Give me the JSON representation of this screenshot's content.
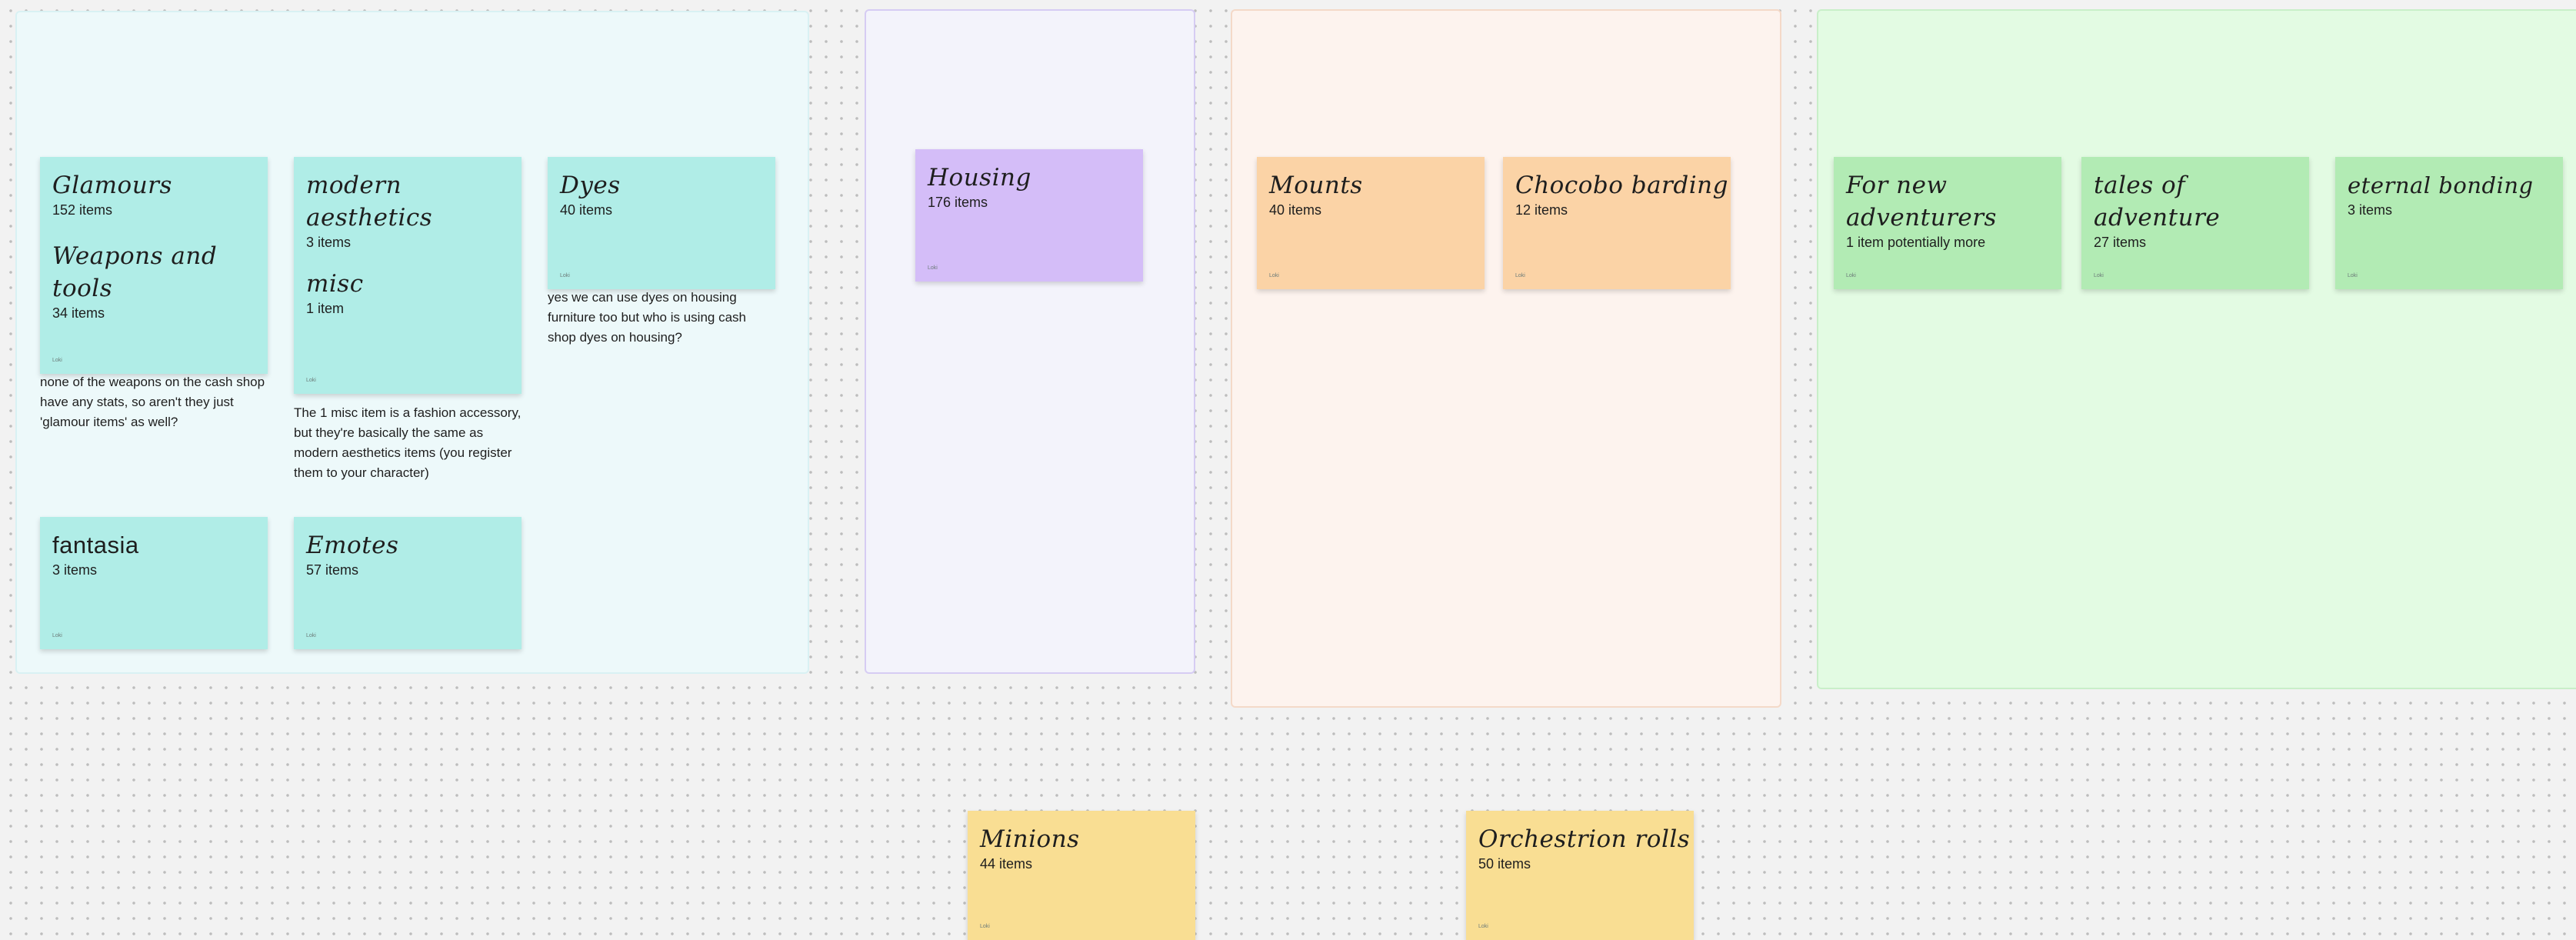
{
  "sections": {
    "cyan": {
      "stickies": {
        "glamours": {
          "title": "Glamours",
          "count": "152 items",
          "author": "Loki"
        },
        "weapons": {
          "title": "Weapons and tools",
          "count": "34 items",
          "author": "Loki"
        },
        "modern": {
          "title": "modern aesthetics",
          "count": "3 items",
          "author": "Loki"
        },
        "misc": {
          "title": "misc",
          "count": "1 item",
          "author": "Loki"
        },
        "dyes": {
          "title": "Dyes",
          "count": "40 items",
          "author": "Loki"
        },
        "fantasia": {
          "title": "fantasia",
          "count": "3 items",
          "author": "Loki"
        },
        "emotes": {
          "title": "Emotes",
          "count": "57 items",
          "author": "Loki"
        }
      },
      "notes": {
        "weapons": "none of the weapons on the cash shop have any stats, so aren't they just 'glamour items' as well?",
        "misc": "The 1 misc item is a fashion accessory, but they're basically the same as modern aesthetics items (you register them to your character)",
        "dyes": "yes we can use dyes on housing furniture too but who is using cash shop dyes on housing?"
      }
    },
    "lavender": {
      "stickies": {
        "housing": {
          "title": "Housing",
          "count": "176 items",
          "author": "Loki"
        }
      }
    },
    "peach": {
      "stickies": {
        "mounts": {
          "title": "Mounts",
          "count": "40 items",
          "author": "Loki"
        },
        "barding": {
          "title": "Chocobo barding",
          "count": "12 items",
          "author": "Loki"
        }
      }
    },
    "green": {
      "stickies": {
        "newadv": {
          "title": "For new adventurers",
          "count": "1 item potentially more",
          "author": "Loki"
        },
        "tales": {
          "title": "tales of adventure",
          "count": "27 items",
          "author": "Loki"
        },
        "eternal": {
          "title": "eternal bonding",
          "count": "3 items",
          "author": "Loki"
        }
      }
    }
  },
  "loose": {
    "minions": {
      "title": "Minions",
      "count": "44 items",
      "author": "Loki"
    },
    "orchestrion": {
      "title": "Orchestrion rolls",
      "count": "50 items",
      "author": "Loki"
    }
  }
}
